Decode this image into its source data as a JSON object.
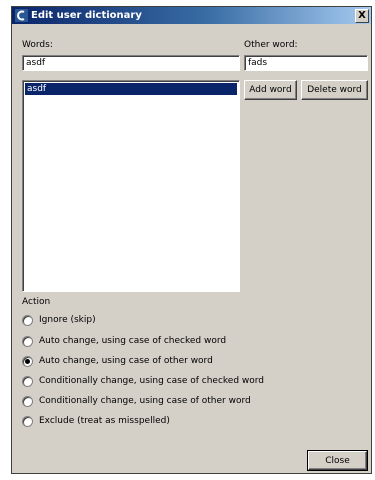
{
  "window": {
    "title": "Edit user dictionary",
    "close_glyph": "X"
  },
  "words": {
    "label": "Words:",
    "input_value": "asdf",
    "list_items": [
      "asdf"
    ],
    "selected_index": 0
  },
  "other_word": {
    "label": "Other word:",
    "input_value": "fads"
  },
  "buttons": {
    "add_word": "Add word",
    "delete_word": "Delete word",
    "close": "Close"
  },
  "action": {
    "label": "Action",
    "options": [
      "Ignore (skip)",
      "Auto change, using case of checked word",
      "Auto change, using case of other word",
      "Conditionally change, using case of checked word",
      "Conditionally change, using case of other word",
      "Exclude (treat as misspelled)"
    ],
    "selected_index": 2
  },
  "colors": {
    "titlebar": "#0a246a",
    "dialog_face": "#d4d0c8",
    "selection": "#0a246a"
  }
}
